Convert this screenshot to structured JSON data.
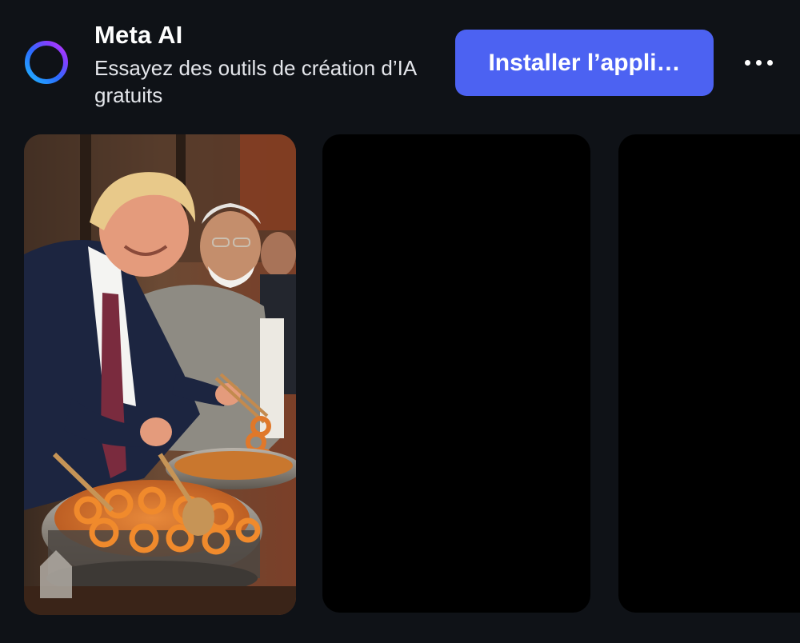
{
  "banner": {
    "app_name": "Meta AI",
    "subtitle": "Essayez des outils de création d’IA gratuits",
    "install_label": "Installer l’appli…",
    "logo_icon": "meta-ai-ring-icon",
    "more_icon": "more-horizontal-icon",
    "accent_color": "#4c62f2"
  },
  "gallery": {
    "cards": [
      {
        "kind": "image",
        "depicts": "two men frying jalebi at a street stall"
      },
      {
        "kind": "blank"
      },
      {
        "kind": "blank"
      }
    ]
  }
}
